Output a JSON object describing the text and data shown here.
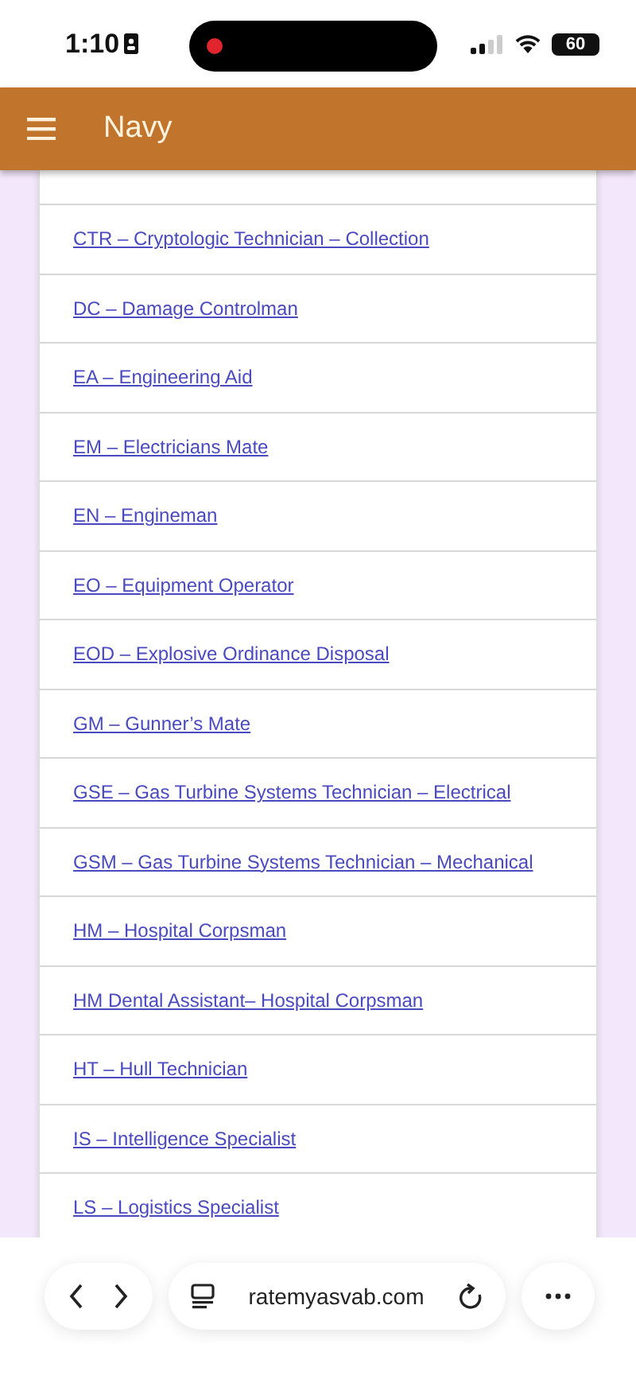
{
  "status_bar": {
    "time": "1:10",
    "battery": "60"
  },
  "header": {
    "title": "Navy"
  },
  "links": [
    {
      "label": "CTR – Cryptologic Technician – Collection"
    },
    {
      "label": "DC – Damage Controlman"
    },
    {
      "label": "EA – Engineering Aid"
    },
    {
      "label": "EM – Electricians Mate"
    },
    {
      "label": "EN – Engineman"
    },
    {
      "label": "EO – Equipment Operator"
    },
    {
      "label": "EOD – Explosive Ordinance Disposal"
    },
    {
      "label": "GM – Gunner’s Mate"
    },
    {
      "label": "GSE – Gas Turbine Systems Technician – Electrical"
    },
    {
      "label": "GSM – Gas Turbine Systems Technician – Mechanical"
    },
    {
      "label": "HM – Hospital Corpsman"
    },
    {
      "label": "HM Dental Assistant– Hospital Corpsman"
    },
    {
      "label": "HT – Hull Technician"
    },
    {
      "label": "IS – Intelligence Specialist"
    },
    {
      "label": "LS – Logistics Specialist"
    }
  ],
  "browser_bar": {
    "url": "ratemyasvab.com"
  }
}
